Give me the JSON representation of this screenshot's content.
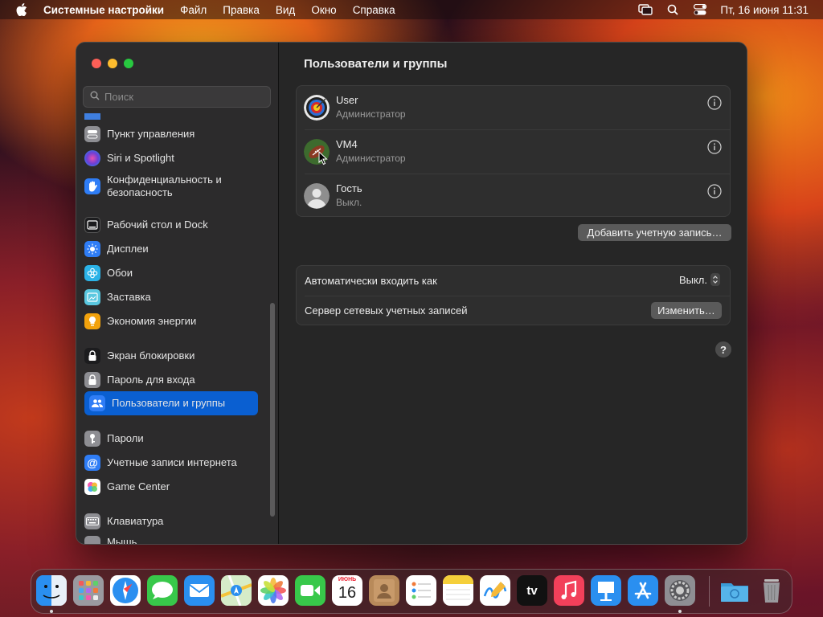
{
  "menubar": {
    "app_name": "Системные настройки",
    "menus": [
      "Файл",
      "Правка",
      "Вид",
      "Окно",
      "Справка"
    ],
    "clock": "Пт, 16 июня  11:31"
  },
  "sidebar": {
    "search_placeholder": "Поиск",
    "items": [
      {
        "label": "Пункт управления",
        "icon": "control-center-icon",
        "color": "#8e8e93"
      },
      {
        "label": "Siri и Spotlight",
        "icon": "siri-icon",
        "color": "#6b3fd6"
      },
      {
        "label": "Конфиденциальность и безопасность",
        "icon": "hand-icon",
        "color": "#2f7df6"
      },
      {
        "label": "Рабочий стол и Dock",
        "icon": "desktop-dock-icon",
        "color": "#1c1c1e"
      },
      {
        "label": "Дисплеи",
        "icon": "sun-icon",
        "color": "#2f7df6"
      },
      {
        "label": "Обои",
        "icon": "flower-icon",
        "color": "#2bb3e8"
      },
      {
        "label": "Заставка",
        "icon": "screensaver-icon",
        "color": "#5ac8e0"
      },
      {
        "label": "Экономия энергии",
        "icon": "bulb-icon",
        "color": "#f2a20c"
      },
      {
        "label": "Экран блокировки",
        "icon": "lock-screen-icon",
        "color": "#1c1c1e"
      },
      {
        "label": "Пароль для входа",
        "icon": "lock-icon",
        "color": "#8e8e93"
      },
      {
        "label": "Пользователи и группы",
        "icon": "users-icon",
        "color": "#2f7df6"
      },
      {
        "label": "Пароли",
        "icon": "key-icon",
        "color": "#8e8e93"
      },
      {
        "label": "Учетные записи интернета",
        "icon": "at-icon",
        "color": "#2f7df6"
      },
      {
        "label": "Game Center",
        "icon": "game-center-icon",
        "color": "#ffffff"
      },
      {
        "label": "Клавиатура",
        "icon": "keyboard-icon",
        "color": "#8e8e93"
      },
      {
        "label": "Мышь",
        "icon": "mouse-icon",
        "color": "#8e8e93"
      }
    ],
    "selected": "Пользователи и группы"
  },
  "content": {
    "title": "Пользователи и группы",
    "users": [
      {
        "name": "User",
        "role": "Администратор",
        "avatar": "target-avatar"
      },
      {
        "name": "VM4",
        "role": "Администратор",
        "avatar": "football-avatar"
      },
      {
        "name": "Гость",
        "role": "Выкл.",
        "avatar": "guest-avatar"
      }
    ],
    "add_account_label": "Добавить учетную запись…",
    "auto_login_label": "Автоматически входить как",
    "auto_login_value": "Выкл.",
    "network_server_label": "Сервер сетевых учетных записей",
    "change_label": "Изменить…",
    "help_label": "?"
  },
  "dock": {
    "calendar_month": "ИЮНЬ",
    "calendar_day": "16",
    "tv_label": "tv",
    "apps": [
      "Finder",
      "Launchpad",
      "Safari",
      "Messages",
      "Mail",
      "Maps",
      "Photos",
      "FaceTime",
      "Calendar",
      "Contacts",
      "Reminders",
      "Notes",
      "Freeform",
      "TV",
      "Music",
      "Keynote",
      "App Store",
      "System Settings",
      "Downloads",
      "Trash"
    ]
  }
}
